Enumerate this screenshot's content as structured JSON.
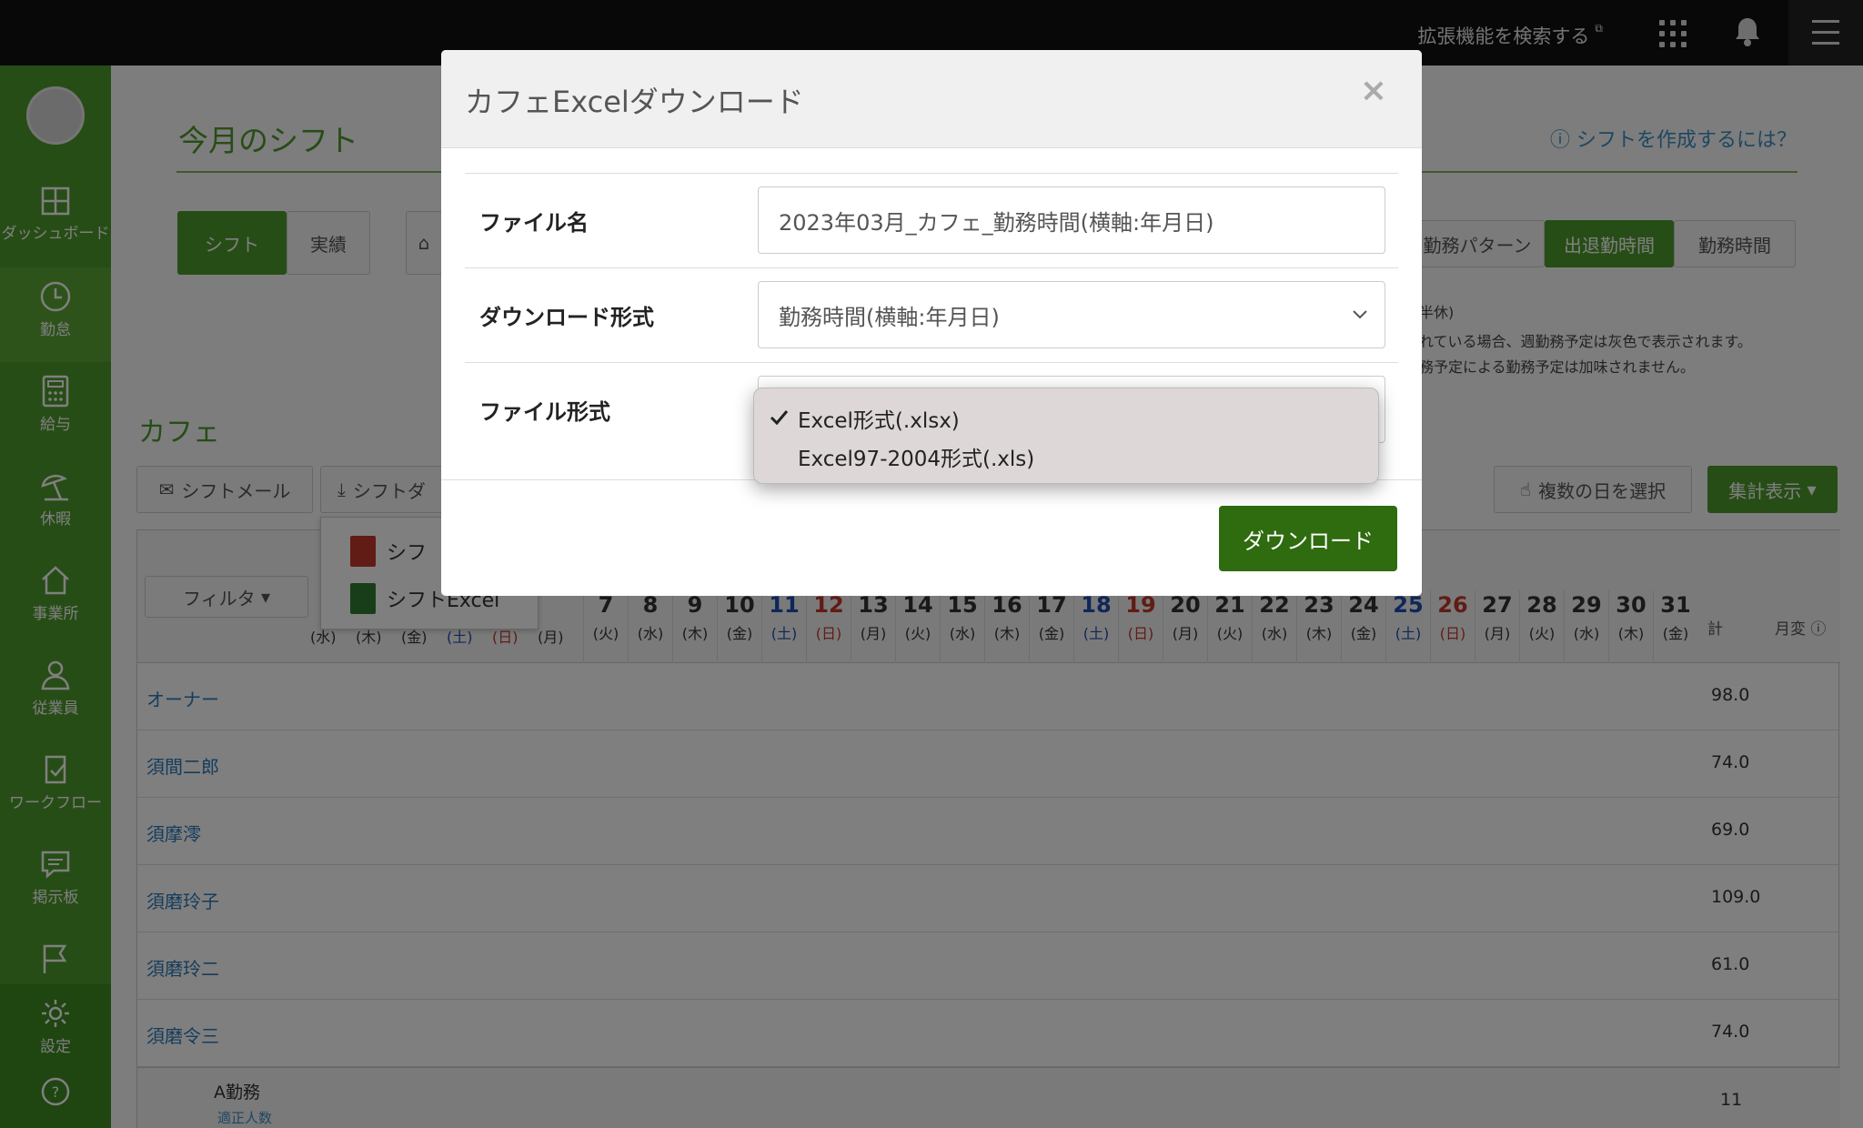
{
  "topbar": {
    "ext_search": "拡張機能を検索する"
  },
  "sidebar": {
    "items": [
      {
        "label": "ダッシュボード",
        "icon": "dashboard-icon"
      },
      {
        "label": "勤怠",
        "icon": "clock-icon"
      },
      {
        "label": "給与",
        "icon": "calculator-icon"
      },
      {
        "label": "休暇",
        "icon": "parasol-icon"
      },
      {
        "label": "事業所",
        "icon": "home-icon"
      },
      {
        "label": "従業員",
        "icon": "person-icon"
      },
      {
        "label": "ワークフロー",
        "icon": "checklist-icon"
      },
      {
        "label": "掲示板",
        "icon": "chat-icon"
      },
      {
        "label": "",
        "icon": "flag-icon"
      },
      {
        "label": "設定",
        "icon": "gear-icon"
      }
    ]
  },
  "page": {
    "title": "今月のシフト",
    "help_link": "シフトを作成するには？",
    "tabs": [
      "シフト",
      "実績"
    ],
    "view_tabs": [
      "勤務パターン",
      "出退勤時間",
      "勤務時間"
    ],
    "notes": [
      "半休)",
      "れている場合、週勤務予定は灰色で表示されます。",
      "務予定による勤務予定は加味されません。"
    ],
    "section": "カフェ",
    "buttons": {
      "mail": "シフトメール",
      "download": "シフトダ",
      "multi_select": "複数の日を選択",
      "aggregate": "集計表示",
      "filter": "フィルタ"
    },
    "download_menu": [
      "シフ",
      "シフトExcel"
    ]
  },
  "table": {
    "days": [
      "7",
      "8",
      "9",
      "10",
      "11",
      "12",
      "13",
      "14",
      "15",
      "16",
      "17",
      "18",
      "19",
      "20",
      "21",
      "22",
      "23",
      "24",
      "25",
      "26",
      "27",
      "28",
      "29",
      "30",
      "31"
    ],
    "weekdays": [
      "(火)",
      "(水)",
      "(木)",
      "(金)",
      "(土)",
      "(日)",
      "(月)",
      "(火)",
      "(水)",
      "(木)",
      "(金)",
      "(土)",
      "(日)",
      "(月)",
      "(火)",
      "(水)",
      "(木)",
      "(金)",
      "(土)",
      "(日)",
      "(月)",
      "(火)",
      "(水)",
      "(木)",
      "(金)"
    ],
    "lead_weekdays": [
      "(水)",
      "(木)",
      "(金)",
      "(土)",
      "(日)",
      "(月)"
    ],
    "total_header": "計",
    "monthly_header": "月変",
    "employees": [
      {
        "name": "オーナー",
        "total": "98.0"
      },
      {
        "name": "須間二郎",
        "total": "74.0"
      },
      {
        "name": "須摩澪",
        "total": "69.0"
      },
      {
        "name": "須磨玲子",
        "total": "109.0"
      },
      {
        "name": "須磨玲二",
        "total": "61.0"
      },
      {
        "name": "須磨令三",
        "total": "74.0"
      }
    ],
    "summary_label": "A勤務",
    "summary_sub": "適正人数",
    "summary_total": "11"
  },
  "modal": {
    "title": "カフェExcelダウンロード",
    "close": "×",
    "filename_label": "ファイル名",
    "filename_value": "2023年03月_カフェ_勤務時間(横軸:年月日)",
    "format_label": "ダウンロード形式",
    "format_value": "勤務時間(横軸:年月日)",
    "filetype_label": "ファイル形式",
    "filetype_options": [
      "Excel形式(.xlsx)",
      "Excel97-2004形式(.xls)"
    ],
    "download_button": "ダウンロード"
  }
}
